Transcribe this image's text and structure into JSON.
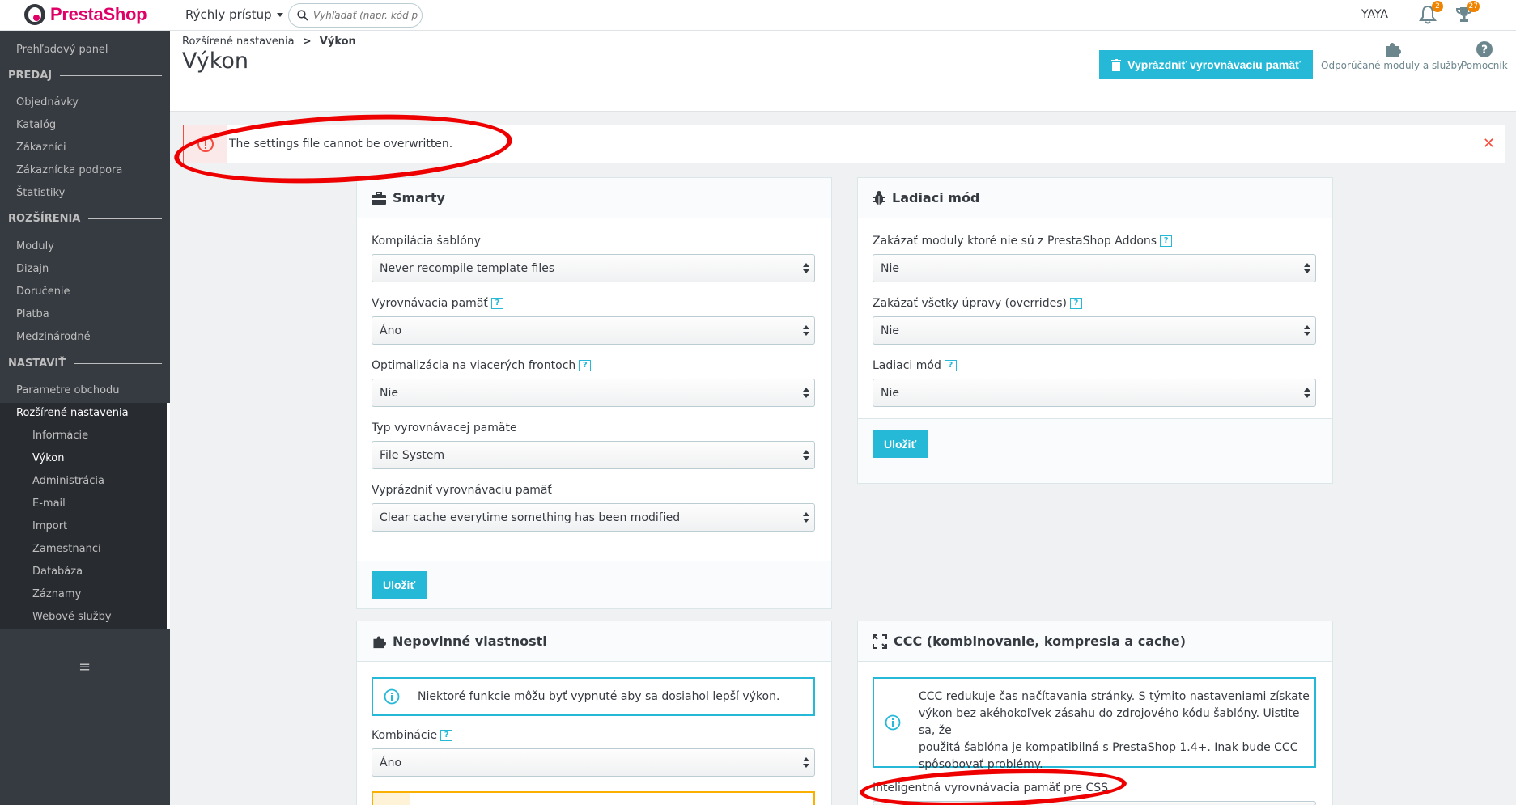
{
  "header": {
    "logo_text": "PrestaShop",
    "quick_access": "Rýchly prístup",
    "search_placeholder": "Vyhľadať (napr. kód pro",
    "user": "YAYA",
    "notif_orders_count": "2",
    "notif_customers_count": "27"
  },
  "sidebar": {
    "dashboard": "Prehľadový panel",
    "section_sell": "PREDAJ",
    "orders": "Objednávky",
    "catalog": "Katalóg",
    "customers": "Zákazníci",
    "support": "Zákaznícka podpora",
    "stats": "Štatistiky",
    "section_extend": "ROZŠÍRENIA",
    "modules": "Moduly",
    "design": "Dizajn",
    "shipping": "Doručenie",
    "payment": "Platba",
    "international": "Medzinárodné",
    "section_configure": "NASTAVIŤ",
    "shop_params": "Parametre obchodu",
    "advanced": "Rozšírené nastavenia",
    "sub_info": "Informácie",
    "sub_performance": "Výkon",
    "sub_admin": "Administrácia",
    "sub_email": "E-mail",
    "sub_import": "Import",
    "sub_employees": "Zamestnanci",
    "sub_db": "Databáza",
    "sub_logs": "Záznamy",
    "sub_webservice": "Webové služby"
  },
  "page": {
    "breadcrumb_parent": "Rozšírené nastavenia",
    "breadcrumb_sep": ">",
    "breadcrumb_current": "Výkon",
    "title": "Výkon",
    "clear_cache_button": "Vyprázdniť vyrovnávaciu pamäť",
    "recommended_modules": "Odporúčané moduly a služby",
    "help": "Pomocník"
  },
  "alert": {
    "text": "The settings file cannot be overwritten."
  },
  "smarty": {
    "title": "Smarty",
    "compile_label": "Kompilácia šablóny",
    "compile_value": "Never recompile template files",
    "cache_label": "Vyrovnávacia pamäť",
    "cache_value": "Áno",
    "multi_front_label": "Optimalizácia na viacerých frontoch",
    "multi_front_value": "Nie",
    "cache_type_label": "Typ vyrovnávacej pamäte",
    "cache_type_value": "File System",
    "clear_label": "Vyprázdniť vyrovnávaciu pamäť",
    "clear_value": "Clear cache everytime something has been modified",
    "save": "Uložiť"
  },
  "debug": {
    "title": "Ladiaci mód",
    "disable_non_native_label": "Zakázať moduly ktoré nie sú z PrestaShop Addons",
    "disable_non_native_value": "Nie",
    "disable_overrides_label": "Zakázať všetky úpravy (overrides)",
    "disable_overrides_value": "Nie",
    "debug_mode_label": "Ladiaci mód",
    "debug_mode_value": "Nie",
    "save": "Uložiť"
  },
  "optional": {
    "title": "Nepovinné vlastnosti",
    "info": "Niektoré funkcie môžu byť vypnuté aby sa dosiahol lepší výkon.",
    "combinations_label": "Kombinácie",
    "combinations_value": "Áno"
  },
  "ccc": {
    "title": "CCC (kombinovanie, kompresia a cache)",
    "info_line1": "CCC redukuje čas načítavania stránky. S týmito nastaveniami získate",
    "info_line2": "výkon bez akéhokoľvek zásahu do zdrojového kódu šablóny. Uistite sa, že",
    "info_line3": "použitá šablóna je kompatibilná s PrestaShop 1.4+. Inak bude CCC",
    "info_line4": "spôsobovať problémy.",
    "css_label": "Inteligentná vyrovnávacia pamäť pre CSS"
  },
  "colors": {
    "accent": "#25b9d7",
    "danger": "#f54c3e",
    "sidebar": "#363a41",
    "brand": "#df0067",
    "annotation": "#ee0000"
  }
}
